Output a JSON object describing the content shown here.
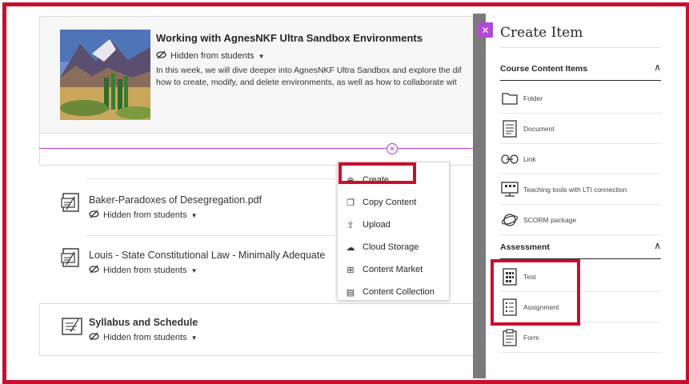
{
  "module": {
    "title": "Working with AgnesNKF Ultra Sandbox Environments",
    "visibility": "Hidden from students",
    "description_line1": "In this week, we will dive deeper into AgnesNKF Ultra Sandbox and explore the dif",
    "description_line2": "how to create, modify, and delete environments, as well as how to collaborate wit"
  },
  "items": [
    {
      "title": "Baker-Paradoxes of Desegregation.pdf",
      "visibility": "Hidden from students"
    },
    {
      "title": "Louis - State Constitutional Law - Minimally Adequate",
      "visibility": "Hidden from students"
    },
    {
      "title": "Syllabus and Schedule",
      "visibility": "Hidden from students"
    }
  ],
  "menu": {
    "items": [
      {
        "label": "Create",
        "icon": "plus-circle-icon"
      },
      {
        "label": "Copy Content",
        "icon": "copy-icon"
      },
      {
        "label": "Upload",
        "icon": "upload-icon"
      },
      {
        "label": "Cloud Storage",
        "icon": "cloud-icon"
      },
      {
        "label": "Content Market",
        "icon": "cart-icon"
      },
      {
        "label": "Content Collection",
        "icon": "collection-icon"
      }
    ]
  },
  "panel": {
    "title": "Create Item",
    "close_icon": "close-icon",
    "course_section": "Course Content Items",
    "course_items": [
      {
        "label": "Folder",
        "icon": "folder-icon"
      },
      {
        "label": "Document",
        "icon": "document-icon"
      },
      {
        "label": "Link",
        "icon": "link-icon"
      },
      {
        "label": "Teaching tools with LTI connection",
        "icon": "lti-icon"
      },
      {
        "label": "SCORM package",
        "icon": "scorm-icon"
      }
    ],
    "assessment_section": "Assessment",
    "assessment_items": [
      {
        "label": "Test",
        "icon": "test-icon"
      },
      {
        "label": "Assignment",
        "icon": "assignment-icon"
      },
      {
        "label": "Form",
        "icon": "form-icon"
      }
    ]
  },
  "colors": {
    "highlight": "#c8102e",
    "accent": "#b13cc7"
  }
}
